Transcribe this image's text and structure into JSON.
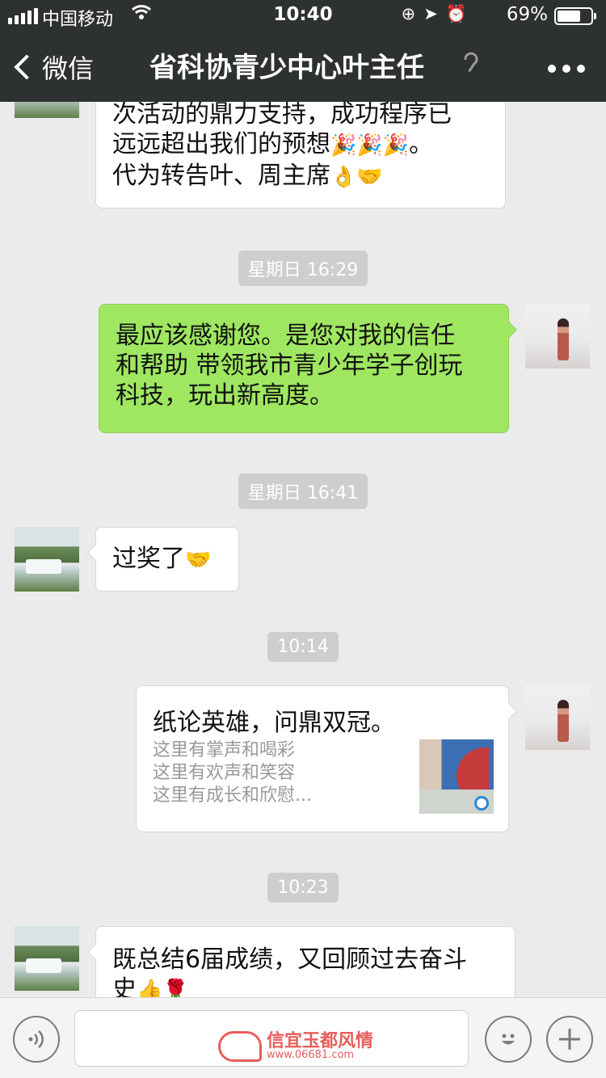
{
  "status": {
    "carrier": "中国移动",
    "time": "10:40",
    "battery_pct": "69%",
    "battery_level": 0.69
  },
  "nav": {
    "back_label": "微信",
    "title": "省科协青少中心叶主任"
  },
  "messages": {
    "m1": {
      "l1": "次活动的鼎力支持，成功程序已",
      "l2": "远远超出我们的预想",
      "l2_emoji": "🎉🎉🎉",
      "l2_tail": "。",
      "l3": "代为转告叶、周主席",
      "l3_emoji": "👌🤝"
    },
    "ts1": "星期日 16:29",
    "m2": {
      "l1": "最应该感谢您。是您对我的信任",
      "l2": "和帮助 带领我市青少年学子创玩",
      "l3": "科技，玩出新高度。"
    },
    "ts2": "星期日 16:41",
    "m3": {
      "text": "过奖了",
      "emoji": "🤝"
    },
    "ts3": "10:14",
    "link": {
      "title": "纸论英雄，问鼎双冠。",
      "d1": "这里有掌声和喝彩",
      "d2": "这里有欢声和笑容",
      "d3": "这里有成长和欣慰..."
    },
    "ts4": "10:23",
    "m5": {
      "l1": "既总结6届成绩，又回顾过去奋斗",
      "l2": "史",
      "l2_emoji": "👍🌹"
    }
  },
  "watermark": {
    "text": "信宜玉都风情",
    "url": "www.06681.com"
  }
}
